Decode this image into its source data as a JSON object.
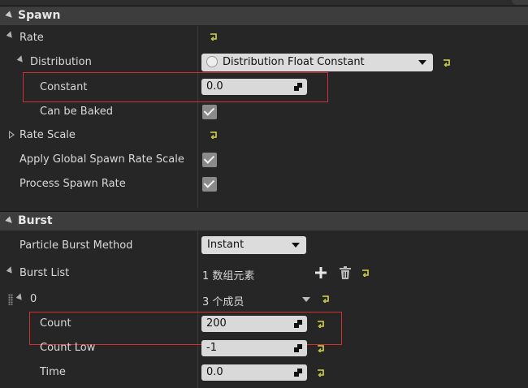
{
  "spawn": {
    "title": "Spawn",
    "rate_label": "Rate",
    "distribution_label": "Distribution",
    "distribution_value": "Distribution Float Constant",
    "constant_label": "Constant",
    "constant_value": "0.0",
    "can_be_baked_label": "Can be Baked",
    "can_be_baked": true,
    "rate_scale_label": "Rate Scale",
    "apply_global_label": "Apply Global Spawn Rate Scale",
    "apply_global": true,
    "process_spawn_rate_label": "Process Spawn Rate",
    "process_spawn_rate": true
  },
  "burst": {
    "title": "Burst",
    "method_label": "Particle Burst Method",
    "method_value": "Instant",
    "list_label": "Burst List",
    "list_count": "1 数组元素",
    "element_index": "0",
    "element_members": "3 个成员",
    "count_label": "Count",
    "count_value": "200",
    "count_low_label": "Count Low",
    "count_low_value": "-1",
    "time_label": "Time",
    "time_value": "0.0"
  },
  "colors": {
    "background": "#262626",
    "header": "#3d3d3d",
    "reset_arrow": "#d6d64a",
    "highlight": "#d23030"
  },
  "icons": [
    "reset-to-default-icon",
    "add-icon",
    "trash-icon",
    "dropdown-caret-icon",
    "expand-arrow-icon",
    "collapse-arrow-icon",
    "drag-grip-icon",
    "radio-icon",
    "spinner-drag-icon",
    "checkmark-icon"
  ]
}
